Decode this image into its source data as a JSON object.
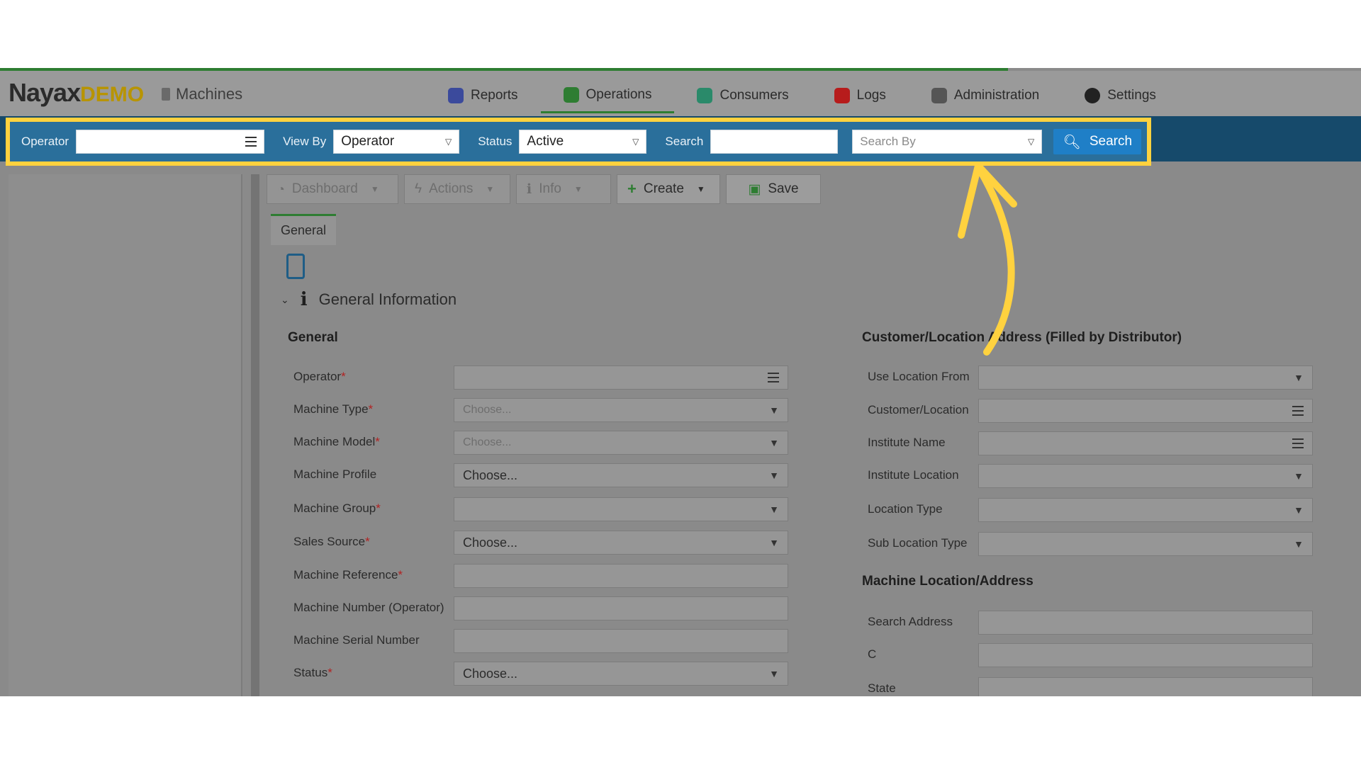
{
  "app": {
    "logo_main": "Nayax",
    "logo_demo": "DEMO",
    "section": "Machines"
  },
  "nav": [
    {
      "label": "Reports",
      "icon": "reports-icon",
      "color": "#3b4a9c"
    },
    {
      "label": "Operations",
      "icon": "operations-icon",
      "color": "#2e7d32",
      "active": true
    },
    {
      "label": "Consumers",
      "icon": "consumers-icon",
      "color": "#2a8a6a"
    },
    {
      "label": "Logs",
      "icon": "logs-icon",
      "color": "#b71c1c"
    },
    {
      "label": "Administration",
      "icon": "administration-icon",
      "color": "#555555"
    },
    {
      "label": "Settings",
      "icon": "settings-icon",
      "color": "#222222"
    }
  ],
  "searchbar": {
    "operator_label": "Operator",
    "operator_value": "",
    "viewby_label": "View By",
    "viewby_value": "Operator",
    "status_label": "Status",
    "status_value": "Active",
    "search_label": "Search",
    "search_value": "",
    "searchby_placeholder": "Search By",
    "search_button": "Search",
    "highlight_color": "#ffd23f"
  },
  "toolbar": {
    "dashboard": "Dashboard",
    "actions": "Actions",
    "info": "Info",
    "create": "Create",
    "save": "Save"
  },
  "tabs": [
    "General"
  ],
  "section": {
    "title": "General Information",
    "left_title": "General",
    "right_title": "Customer/Location Address (Filled by Distributor)",
    "right_title2": "Machine Location/Address"
  },
  "left_fields": [
    {
      "label": "Operator",
      "required": true,
      "value": "",
      "kind": "list"
    },
    {
      "label": "Machine Type",
      "required": true,
      "value": "Choose...",
      "placeholder": true,
      "kind": "select"
    },
    {
      "label": "Machine Model",
      "required": true,
      "value": "Choose...",
      "placeholder": true,
      "kind": "select"
    },
    {
      "label": "Machine Profile",
      "required": false,
      "value": "Choose...",
      "kind": "select"
    },
    {
      "label": "Machine Group",
      "required": true,
      "value": "",
      "kind": "select"
    },
    {
      "label": "Sales Source",
      "required": true,
      "value": "Choose...",
      "kind": "select"
    },
    {
      "label": "Machine Reference",
      "required": true,
      "value": "",
      "kind": "text"
    },
    {
      "label": "Machine Number (Operator)",
      "required": false,
      "value": "",
      "kind": "text"
    },
    {
      "label": "Machine Serial Number",
      "required": false,
      "value": "",
      "kind": "text"
    },
    {
      "label": "Status",
      "required": true,
      "value": "Choose...",
      "kind": "select"
    }
  ],
  "right_fields": [
    {
      "label": "Use Location From",
      "kind": "select"
    },
    {
      "label": "Customer/Location",
      "kind": "list"
    },
    {
      "label": "Institute Name",
      "kind": "list"
    },
    {
      "label": "Institute Location",
      "kind": "select"
    },
    {
      "label": "Location Type",
      "kind": "select"
    },
    {
      "label": "Sub Location Type",
      "kind": "select"
    }
  ],
  "right_fields2": [
    {
      "label": "Search Address",
      "kind": "text"
    },
    {
      "label": "C",
      "kind": "text"
    },
    {
      "label": "State",
      "kind": "text"
    }
  ],
  "annotation": {
    "arrow_color": "#ffd23f"
  }
}
